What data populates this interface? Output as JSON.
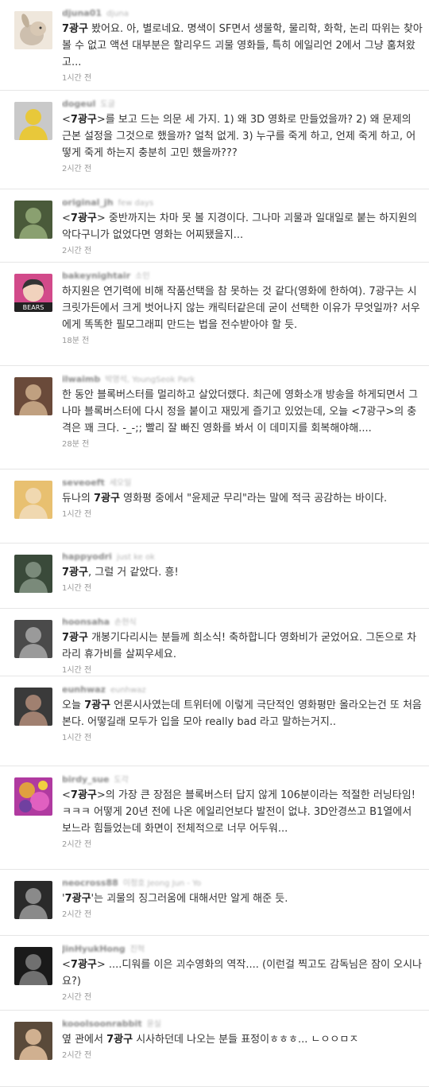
{
  "highlight": "7광구",
  "tweets": [
    {
      "username": "djuna01",
      "realname": "djuna",
      "avatar_icon": "rabbit-avatar",
      "avatar_colors": [
        "#cdbfae",
        "#efe7dc"
      ],
      "text_before": "",
      "text_after": " 봤어요. 아, 별로네요. 명색이 SF면서 생물학, 물리학, 화학, 논리 따위는 찾아볼 수 없고 액션 대부분은 할리우드 괴물 영화들, 특히 에일리언 2에서 그냥 훔쳐왔고...",
      "time": "1시간 전"
    },
    {
      "username": "dogeul",
      "realname": "도글",
      "avatar_icon": "person-avatar",
      "avatar_colors": [
        "#c9c9c9",
        "#e8c83a"
      ],
      "text_before": "<",
      "text_after": ">를 보고 드는 의문 세 가지. 1) 왜 3D 영화로 만들었을까? 2) 왜 문제의 근본 설정을 그것으로 했을까? 얼척 없게. 3) 누구를 죽게 하고, 언제 죽게 하고, 어떻게 죽게 하는지 충분히 고민 했을까???",
      "time": "2시간 전"
    },
    {
      "username": "original_jh",
      "realname": "few days",
      "avatar_icon": "person-avatar",
      "avatar_colors": [
        "#4a5a3a",
        "#8aa070"
      ],
      "text_before": "<",
      "text_after": "> 중반까지는 차마 못 볼 지경이다. 그나마 괴물과 일대일로 붙는 하지원의 악다구니가 없었다면 영화는 어찌됐을지...",
      "time": "2시간 전"
    },
    {
      "username": "bakeynightair",
      "realname": "소인",
      "avatar_icon": "bears-avatar",
      "avatar_colors": [
        "#d24a8a",
        "#333333"
      ],
      "text_before": "",
      "text_after": "하지원은 연기력에 비해 작품선택을 참 못하는 것 같다(영화에 한하여). 7광구는 시크릿가든에서 크게 벗어나지 않는 캐릭터같은데 굳이 선택한 이유가 무엇일까? 서우에게 똑똑한 필모그래피 만드는 법을 전수받아야 할 듯.",
      "time": "18분 전"
    },
    {
      "username": "ilwaimb",
      "realname": "박영석, YoungSeok Park",
      "avatar_icon": "person-avatar",
      "avatar_colors": [
        "#6a4a3a",
        "#c0a080"
      ],
      "text_before": "",
      "text_after": "한 동안 블록버스터를 멀리하고 살았더랬다. 최근에 영화소개 방송을 하게되면서 그나마 블록버스터에 다시 정을 붙이고 재밌게 즐기고 있었는데, 오늘 <7광구>의 충격은 꽤 크다. -_-;; 빨리 잘 빠진 영화를 봐서 이 데미지를 회복해야해....",
      "time": "28분 전"
    },
    {
      "username": "seveoeft",
      "realname": "세오일",
      "avatar_icon": "person-avatar",
      "avatar_colors": [
        "#e8c070",
        "#f0d8b0"
      ],
      "text_before": "듀나의 ",
      "text_after": " 영화평 중에서 \"윤제균 무리\"라는 말에 적극 공감하는 바이다.",
      "time": "1시간 전"
    },
    {
      "username": "happyodri",
      "realname": "just ke ok",
      "avatar_icon": "person-avatar",
      "avatar_colors": [
        "#3a4a3a",
        "#7a8a7a"
      ],
      "text_before": "",
      "text_after": ", 그럴 거 같았다. 흥!",
      "time": "1시간 전"
    },
    {
      "username": "hoonsaha",
      "realname": "손현식",
      "avatar_icon": "person-avatar",
      "avatar_colors": [
        "#4a4a4a",
        "#9a9a9a"
      ],
      "text_before": "",
      "text_after": " 개봉기다리시는 분들께 희소식! 축하합니다 영화비가 굳었어요. 그돈으로 차라리 휴가비를 살찌우세요.",
      "time": "1시간 전"
    },
    {
      "username": "eunhwaz",
      "realname": "eunhwaz",
      "avatar_icon": "person-avatar",
      "avatar_colors": [
        "#3a3a3a",
        "#a08070"
      ],
      "text_before": "오늘 ",
      "text_after": " 언론시사였는데 트위터에 이렇게 극단적인 영화평만 올라오는건 또 처음본다. 어떻길래 모두가 입을 모아 really bad 라고 말하는거지..",
      "time": "1시간 전"
    },
    {
      "username": "birdy_sue",
      "realname": "도각",
      "avatar_icon": "colorful-avatar",
      "avatar_colors": [
        "#b03aa0",
        "#e0a040"
      ],
      "text_before": "<",
      "text_after": ">의 가장 큰 장점은 블록버스터 답지 않게 106분이라는 적절한 러닝타임! ㅋㅋㅋ 어떻게 20년 전에 나온 에일리언보다 발전이 없냐. 3D안경쓰고 B1열에서 보느라 힘들었는데 화면이 전체적으로 너무 어두워...",
      "time": "2시간 전"
    },
    {
      "username": "neocross88",
      "realname": "이정호 Jeong Jun - Yo",
      "avatar_icon": "person-avatar",
      "avatar_colors": [
        "#2a2a2a",
        "#8a8a8a"
      ],
      "text_before": "'",
      "text_after": "'는 괴물의 징그러움에 대해서만 알게 해준 듯.",
      "time": "2시간 전"
    },
    {
      "username": "JinHyukHong",
      "realname": "진혁",
      "avatar_icon": "person-avatar",
      "avatar_colors": [
        "#1a1a1a",
        "#707070"
      ],
      "text_before": "<",
      "text_after": "> ....디워를 이은 괴수영화의 역작.... (이런걸 찍고도 감독님은 잠이 오시나요?)",
      "time": "2시간 전"
    },
    {
      "username": "kooolsoonrabbit",
      "realname": "윤실",
      "avatar_icon": "person-avatar",
      "avatar_colors": [
        "#5a4a3a",
        "#d0b090"
      ],
      "text_before": "옆 관에서 ",
      "text_after": " 시사하던데 나오는 분들 표정이ㅎㅎㅎ... ㄴㅇㅇㅁㅈ",
      "time": "2시간 전"
    }
  ]
}
